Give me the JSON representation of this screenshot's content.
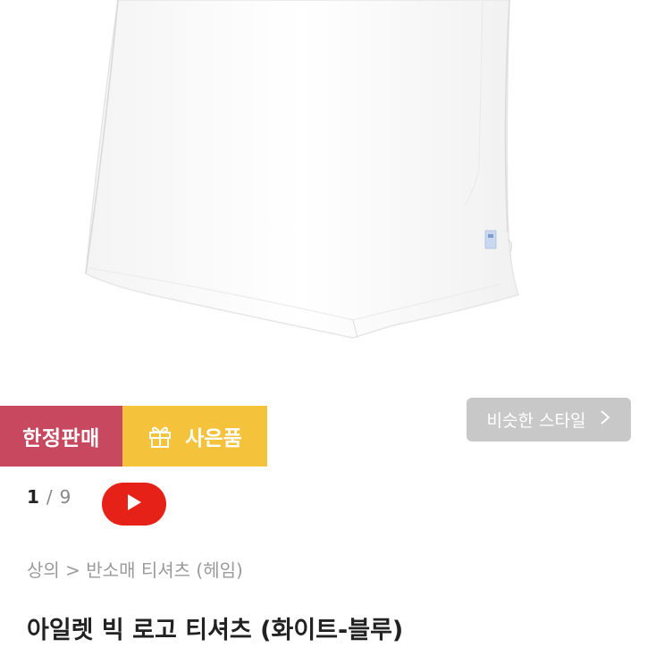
{
  "badges": {
    "limited_label": "한정판매",
    "gift_label": "사은품"
  },
  "similar_style": {
    "label": "비슷한 스타일"
  },
  "pager": {
    "current": "1",
    "separator": "/",
    "total": "9"
  },
  "breadcrumb": {
    "text": "상의 > 반소매 티셔츠 (헤임)"
  },
  "product": {
    "title": "아일렛 빅 로고 티셔츠 (화이트-블루)"
  },
  "icons": {
    "gift": "gift-icon",
    "chevron": "chevron-right-icon",
    "play": "play-icon"
  },
  "colors": {
    "limited_badge": "#c8485f",
    "gift_badge": "#f5c33b",
    "similar_button": "#c8c8c8",
    "video_button": "#e62117"
  }
}
